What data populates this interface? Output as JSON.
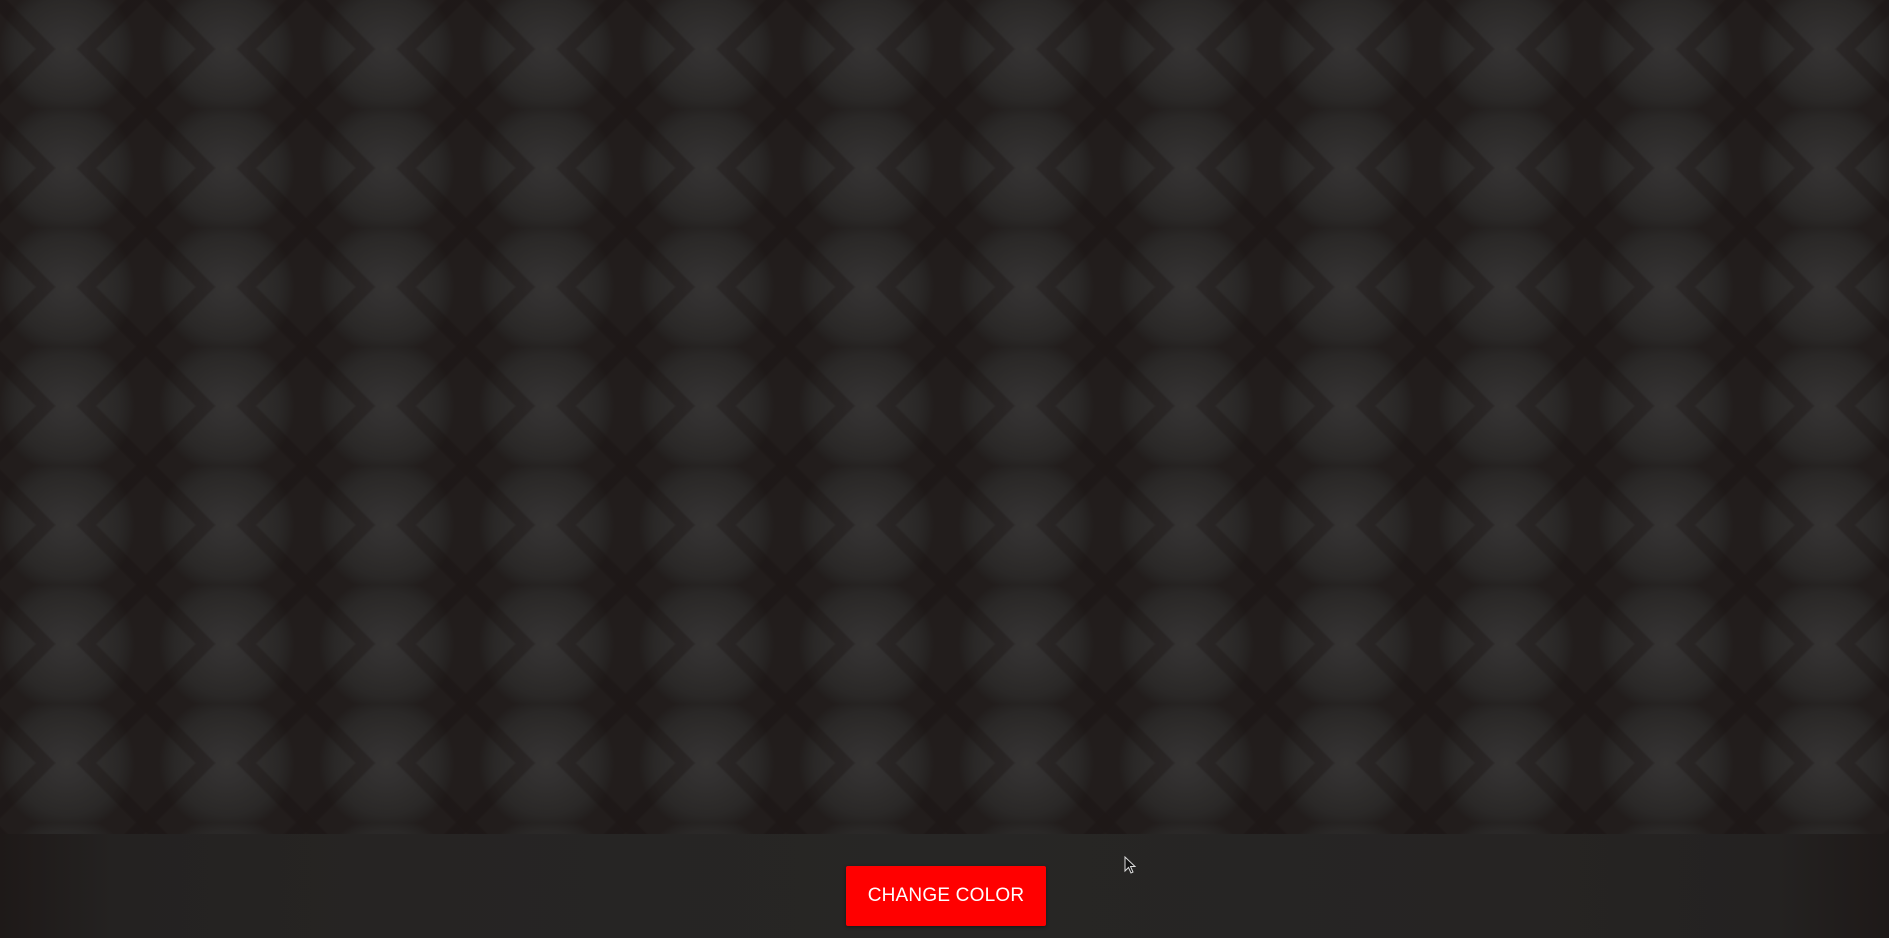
{
  "background": {
    "pattern_color": "#221d1c",
    "circle_color": "#363433"
  },
  "bottom_bar": {
    "button_label": "CHANGE COLOR",
    "button_color": "#ff0000"
  },
  "cursor": {
    "icon": "mouse-pointer-icon"
  }
}
